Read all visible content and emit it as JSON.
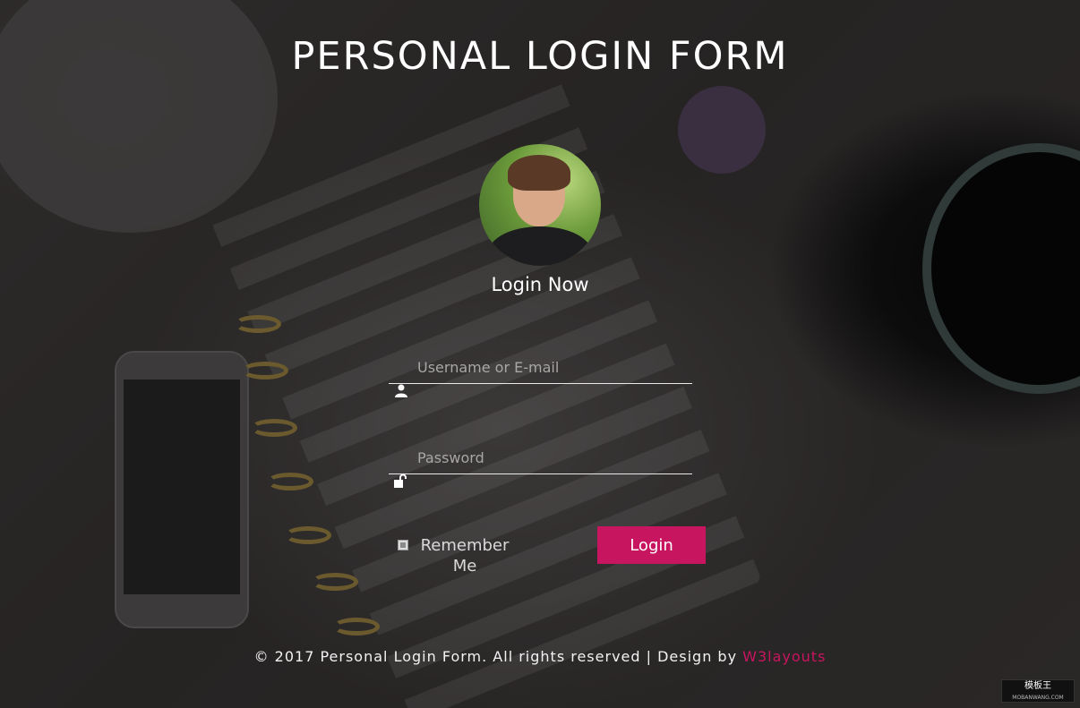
{
  "page": {
    "title": "PERSONAL LOGIN FORM",
    "subtitle": "Login Now"
  },
  "form": {
    "username_placeholder": "Username or E-mail",
    "username_value": "",
    "password_placeholder": "Password",
    "password_value": "",
    "remember_label": "Remember Me",
    "remember_checked": false,
    "login_label": "Login"
  },
  "icons": {
    "username": "user-icon",
    "password": "unlock-icon",
    "avatar": "profile-photo"
  },
  "footer": {
    "text": "© 2017 Personal Login Form. All rights reserved | Design by ",
    "link_label": "W3layouts"
  },
  "watermark": {
    "label": "模板王",
    "sub": "MOBANWANG.COM"
  },
  "colors": {
    "accent": "#c8155f",
    "text": "#ffffff"
  }
}
